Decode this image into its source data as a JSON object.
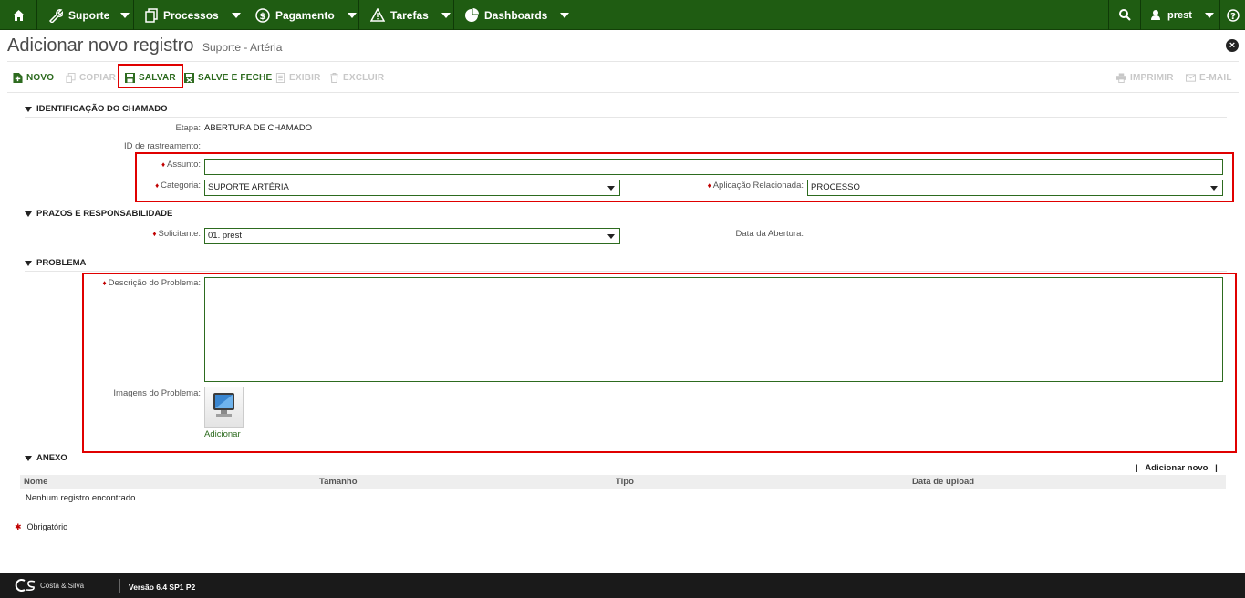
{
  "nav": {
    "items": [
      {
        "label": "Suporte"
      },
      {
        "label": "Processos"
      },
      {
        "label": "Pagamento"
      },
      {
        "label": "Tarefas"
      },
      {
        "label": "Dashboards"
      }
    ],
    "user": "prest"
  },
  "header": {
    "title": "Adicionar novo registro",
    "subtitle": "Suporte - Artéria"
  },
  "toolbar": {
    "novo": "NOVO",
    "copiar": "COPIAR",
    "salvar": "SALVAR",
    "salve_feche": "SALVE E FECHE",
    "exibir": "EXIBIR",
    "excluir": "EXCLUIR",
    "imprimir": "IMPRIMIR",
    "email": "E-MAIL"
  },
  "sections": {
    "identificacao": "IDENTIFICAÇÃO DO CHAMADO",
    "prazos": "PRAZOS E RESPONSABILIDADE",
    "problema": "PROBLEMA",
    "anexo": "ANEXO"
  },
  "fields": {
    "etapa_label": "Etapa:",
    "etapa_value": "ABERTURA DE CHAMADO",
    "rastreamento_label": "ID de rastreamento:",
    "assunto_label": "Assunto:",
    "assunto_value": "",
    "categoria_label": "Categoria:",
    "categoria_value": "SUPORTE ARTÉRIA",
    "aplicacao_label": "Aplicação Relacionada:",
    "aplicacao_value": "PROCESSO",
    "solicitante_label": "Solicitante:",
    "solicitante_value": "01. prest",
    "abertura_label": "Data da Abertura:",
    "descricao_label": "Descrição do Problema:",
    "imagens_label": "Imagens do Problema:",
    "adicionar_label": "Adicionar"
  },
  "anexo": {
    "add_new": "Adicionar novo",
    "columns": [
      "Nome",
      "Tamanho",
      "Tipo",
      "Data de upload"
    ],
    "empty": "Nenhum registro encontrado"
  },
  "required_note": "Obrigatório",
  "footer": {
    "brand": "Costa & Silva",
    "version": "Versão 6.4 SP1 P2"
  },
  "colors": {
    "nav_bg": "#1f5c12",
    "accent": "#2d6b1f",
    "highlight": "#e00000",
    "footer_bg": "#1a1a1a"
  }
}
